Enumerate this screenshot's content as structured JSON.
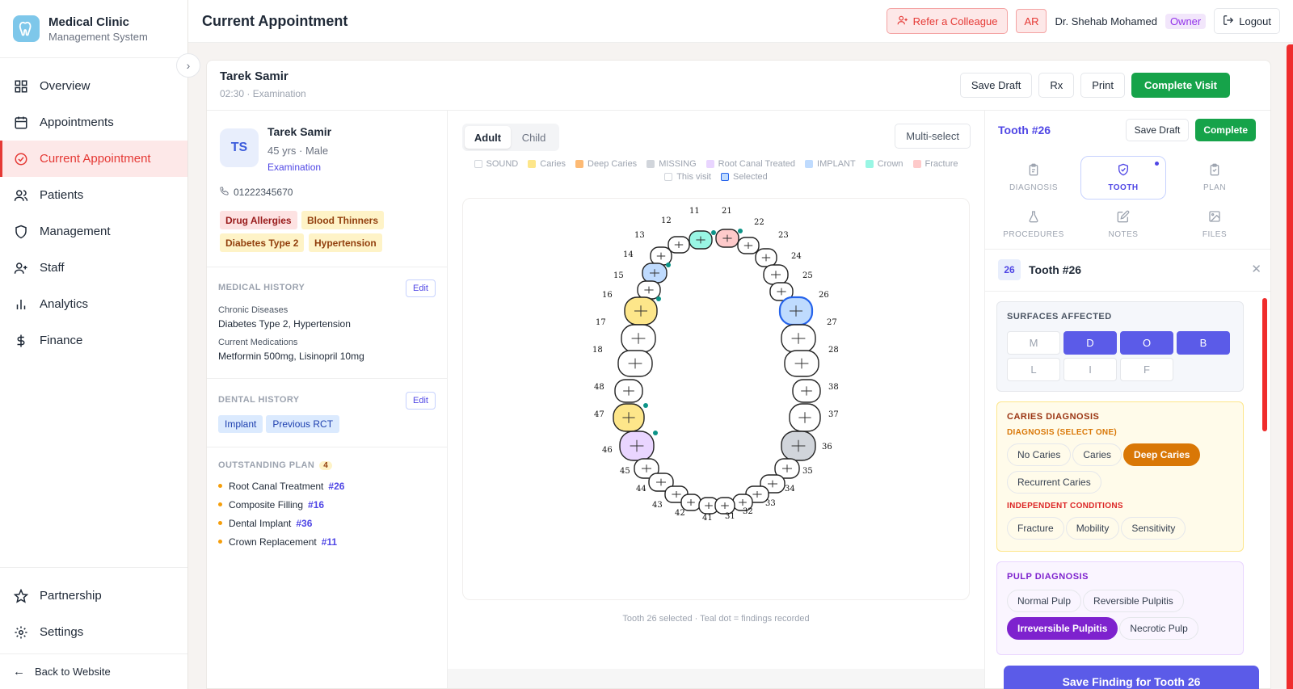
{
  "brand": {
    "name": "Medical Clinic",
    "subtitle": "Management System"
  },
  "nav": [
    {
      "label": "Overview",
      "icon": "grid-icon"
    },
    {
      "label": "Appointments",
      "icon": "calendar-icon"
    },
    {
      "label": "Current Appointment",
      "icon": "check-circle-icon",
      "active": true
    },
    {
      "label": "Patients",
      "icon": "users-icon"
    },
    {
      "label": "Management",
      "icon": "shield-icon"
    },
    {
      "label": "Staff",
      "icon": "user-plus-icon"
    },
    {
      "label": "Analytics",
      "icon": "bar-chart-icon"
    },
    {
      "label": "Finance",
      "icon": "dollar-icon"
    }
  ],
  "nav_bottom": {
    "partnership": "Partnership",
    "settings": "Settings",
    "back": "Back to Website"
  },
  "topbar": {
    "title": "Current Appointment",
    "refer": "Refer a Colleague",
    "lang": "AR",
    "doctor": "Dr. Shehab Mohamed",
    "role": "Owner",
    "logout": "Logout"
  },
  "visit": {
    "patient": "Tarek Samir",
    "meta": "02:30 · Examination",
    "actions": {
      "save_draft": "Save Draft",
      "rx": "Rx",
      "print": "Print",
      "complete": "Complete Visit"
    }
  },
  "patient": {
    "initials": "TS",
    "name": "Tarek Samir",
    "age_sex": "45 yrs · Male",
    "type": "Examination",
    "phone": "01222345670",
    "tags": [
      "Drug Allergies",
      "Blood Thinners",
      "Diabetes Type 2",
      "Hypertension"
    ],
    "medical_history": {
      "title": "MEDICAL HISTORY",
      "edit": "Edit",
      "chronic_label": "Chronic Diseases",
      "chronic_value": "Diabetes Type 2, Hypertension",
      "meds_label": "Current Medications",
      "meds_value": "Metformin 500mg, Lisinopril 10mg"
    },
    "dental_history": {
      "title": "DENTAL HISTORY",
      "edit": "Edit",
      "chips": [
        "Implant",
        "Previous RCT"
      ]
    },
    "plan": {
      "title": "OUTSTANDING PLAN",
      "count": "4",
      "items": [
        {
          "label": "Root Canal Treatment",
          "tooth": "#26"
        },
        {
          "label": "Composite Filling",
          "tooth": "#16"
        },
        {
          "label": "Dental Implant",
          "tooth": "#36"
        },
        {
          "label": "Crown Replacement",
          "tooth": "#11"
        }
      ]
    }
  },
  "chart": {
    "toggle": {
      "adult": "Adult",
      "child": "Child"
    },
    "multi": "Multi-select",
    "legend": [
      {
        "label": "SOUND",
        "color": "#ffffff"
      },
      {
        "label": "Caries",
        "color": "#fde68a"
      },
      {
        "label": "Deep Caries",
        "color": "#fdba74"
      },
      {
        "label": "MISSING",
        "color": "#d1d5db"
      },
      {
        "label": "Root Canal Treated",
        "color": "#e9d5ff"
      },
      {
        "label": "IMPLANT",
        "color": "#bfdbfe"
      },
      {
        "label": "Crown",
        "color": "#99f6e4"
      },
      {
        "label": "Fracture",
        "color": "#fecaca"
      },
      {
        "label": "This visit",
        "color": "#ffffff"
      },
      {
        "label": "Selected",
        "color": "#bfdbfe"
      }
    ],
    "caption": "Tooth 26 selected · Teal dot = findings recorded",
    "teeth_labels": [
      "11",
      "21",
      "12",
      "22",
      "13",
      "23",
      "14",
      "24",
      "15",
      "25",
      "16",
      "26",
      "17",
      "27",
      "18",
      "28",
      "48",
      "38",
      "47",
      "37",
      "46",
      "36",
      "45",
      "35",
      "44",
      "34",
      "43",
      "33",
      "42",
      "32",
      "41",
      "31"
    ]
  },
  "findings": {
    "title": "Tooth #26",
    "save_draft": "Save Draft",
    "complete": "Complete",
    "tabs": [
      {
        "label": "DIAGNOSIS",
        "icon": "clipboard-icon"
      },
      {
        "label": "TOOTH",
        "icon": "shield-icon",
        "active": true
      },
      {
        "label": "PLAN",
        "icon": "clipboard-check-icon"
      },
      {
        "label": "PROCEDURES",
        "icon": "flask-icon"
      },
      {
        "label": "NOTES",
        "icon": "edit-icon"
      },
      {
        "label": "FILES",
        "icon": "image-icon"
      }
    ],
    "tooth_num": "26",
    "tooth_label": "Tooth #26",
    "surfaces": {
      "title": "SURFACES AFFECTED",
      "items": [
        {
          "label": "M",
          "on": false
        },
        {
          "label": "D",
          "on": true
        },
        {
          "label": "O",
          "on": true
        },
        {
          "label": "B",
          "on": true
        },
        {
          "label": "L",
          "on": false
        },
        {
          "label": "I",
          "on": false
        },
        {
          "label": "F",
          "on": false
        }
      ]
    },
    "caries": {
      "title": "CARIES DIAGNOSIS",
      "sub": "DIAGNOSIS (SELECT ONE)",
      "options": [
        "No Caries",
        "Caries",
        "Deep Caries",
        "Recurrent Caries"
      ],
      "selected": "Deep Caries",
      "indep_title": "INDEPENDENT CONDITIONS",
      "indep": [
        "Fracture",
        "Mobility",
        "Sensitivity"
      ]
    },
    "pulp": {
      "title": "PULP DIAGNOSIS",
      "options": [
        "Normal Pulp",
        "Reversible Pulpitis",
        "Irreversible Pulpitis",
        "Necrotic Pulp"
      ],
      "selected": "Irreversible Pulpitis"
    },
    "save_finding": "Save Finding for Tooth 26"
  }
}
